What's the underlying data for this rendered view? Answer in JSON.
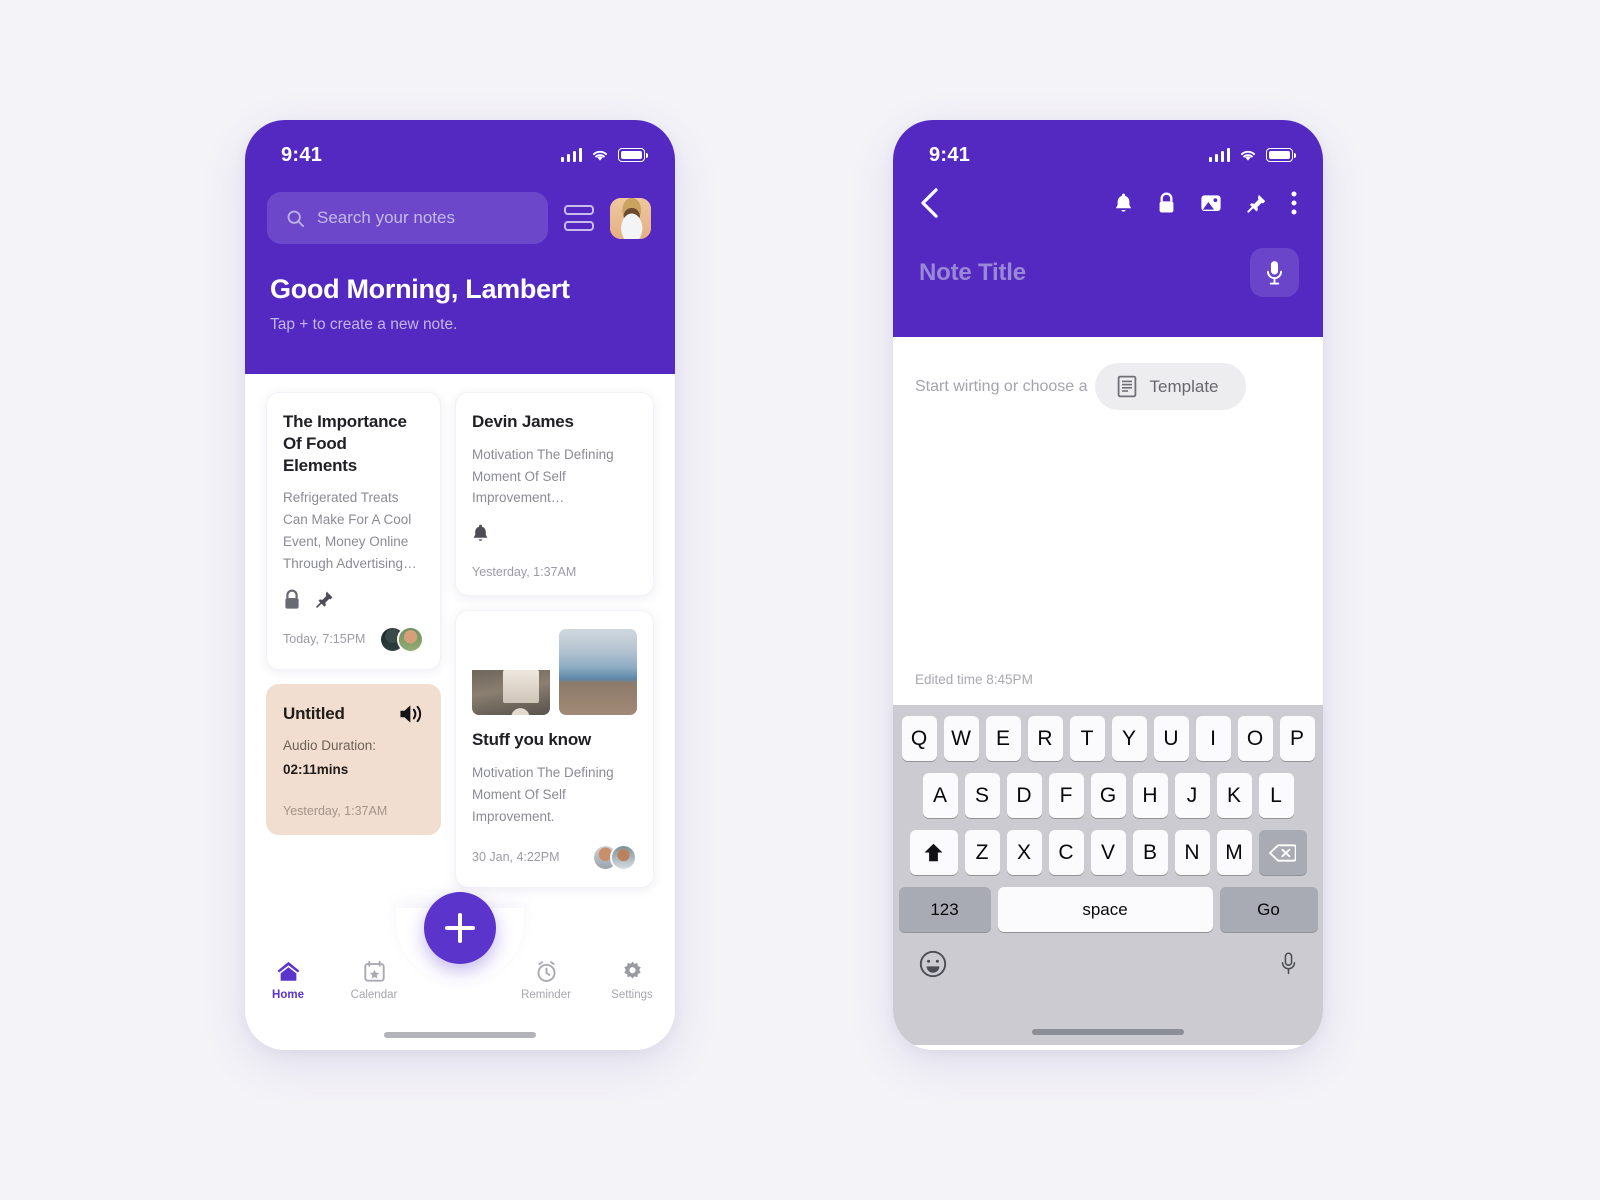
{
  "app": {
    "accent": "#5b34cc",
    "header_purple": "#5429c2",
    "page_bg": "#f4f3f8"
  },
  "home": {
    "status": {
      "time": "9:41",
      "signal_icon": "signal-bars-icon",
      "wifi_icon": "wifi-icon",
      "battery_icon": "battery-icon"
    },
    "search": {
      "placeholder": "Search your notes",
      "icon": "search-icon"
    },
    "list_toggle_icon": "list-view-icon",
    "avatar_name": "user-avatar",
    "greeting": "Good Morning, Lambert",
    "subtitle": "Tap + to create a new note.",
    "notes": [
      {
        "id": "food-elements",
        "title": "The Importance Of Food Elements",
        "body": "Refrigerated Treats Can Make For A Cool Event, Money Online Through Advertising…",
        "icons": [
          "lock-icon",
          "pin-icon"
        ],
        "timestamp": "Today, 7:15PM",
        "collaborators": 2,
        "variant": "white"
      },
      {
        "id": "untitled-audio",
        "title": "Untitled",
        "audio_label": "Audio Duration:",
        "audio_duration": "02:11mins",
        "icons": [
          "speaker-icon"
        ],
        "timestamp": "Yesterday, 1:37AM",
        "variant": "tan"
      },
      {
        "id": "devin-james",
        "title": "Devin James",
        "body": "Motivation The Defining Moment Of Self Improvement…",
        "icons": [
          "bell-icon"
        ],
        "timestamp": "Yesterday, 1:37AM",
        "variant": "white"
      },
      {
        "id": "stuff-you-know",
        "title": "Stuff you know",
        "body": "Motivation The Defining Moment Of Self Improvement.",
        "thumbnails": [
          "house-photo",
          "sky-photo"
        ],
        "timestamp": "30 Jan, 4:22PM",
        "collaborators": 2,
        "variant": "white"
      }
    ],
    "tabs": [
      {
        "label": "Home",
        "icon": "home-icon",
        "active": true
      },
      {
        "label": "Calendar",
        "icon": "calendar-icon",
        "active": false
      },
      {
        "label": "Reminder",
        "icon": "alarm-clock-icon",
        "active": false
      },
      {
        "label": "Settings",
        "icon": "gear-icon",
        "active": false
      }
    ],
    "fab": {
      "label": "+",
      "name": "add-note-button"
    }
  },
  "editor": {
    "status": {
      "time": "9:41"
    },
    "back_icon": "back-chevron-icon",
    "toolbar_icons": [
      "bell-icon",
      "lock-icon",
      "image-icon",
      "pin-icon",
      "more-vertical-icon"
    ],
    "title_placeholder": "Note Title",
    "mic_icon": "microphone-icon",
    "hint": "Start wirting or choose a",
    "template_chip": {
      "label": "Template",
      "icon": "document-icon"
    },
    "edited_time": "Edited time 8:45PM",
    "keyboard": {
      "row1": [
        "Q",
        "W",
        "E",
        "R",
        "T",
        "Y",
        "U",
        "I",
        "O",
        "P"
      ],
      "row2": [
        "A",
        "S",
        "D",
        "F",
        "G",
        "H",
        "J",
        "K",
        "L"
      ],
      "row3": [
        "Z",
        "X",
        "C",
        "V",
        "B",
        "N",
        "M"
      ],
      "shift_icon": "shift-up-icon",
      "backspace_icon": "backspace-icon",
      "numbers_key": "123",
      "space_key": "space",
      "return_key": "Go",
      "emoji_icon": "emoji-smiley-icon",
      "dictation_icon": "microphone-icon"
    }
  }
}
